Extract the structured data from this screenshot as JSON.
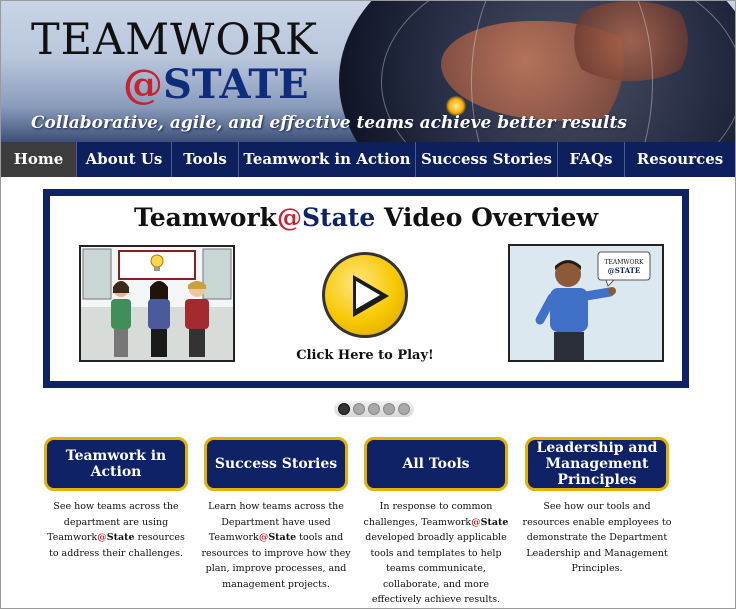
{
  "brand": {
    "line1": "TEAMWORK",
    "at": "@",
    "line2": "STATE",
    "tagline": "Collaborative, agile, and effective teams achieve better results"
  },
  "nav": {
    "items": [
      {
        "label": "Home",
        "active": true
      },
      {
        "label": "About Us"
      },
      {
        "label": "Tools"
      },
      {
        "label": "Teamwork in Action"
      },
      {
        "label": "Success Stories"
      },
      {
        "label": "FAQs"
      },
      {
        "label": "Resources"
      }
    ]
  },
  "video": {
    "title_a": "Teamwork",
    "title_at": "@",
    "title_b": "State",
    "title_c": " Video Overview",
    "play_label": "Click Here to Play!",
    "sign_line1": "TEAMWORK",
    "sign_line2": "@STATE"
  },
  "carousel": {
    "dot_count": 5,
    "active_index": 0
  },
  "cards": [
    {
      "title": "Teamwork in Action",
      "desc_pre": "See how teams across the department are using Teamwork",
      "desc_at": "@",
      "desc_brand": "State",
      "desc_post": " resources to address their challenges."
    },
    {
      "title": "Success Stories",
      "desc_pre": "Learn how teams across the Department have used Teamwork",
      "desc_at": "@",
      "desc_brand": "State",
      "desc_post": " tools and resources to improve how they plan, improve processes, and management projects."
    },
    {
      "title": "All Tools",
      "desc_pre": "In response to common challenges, Teamwork",
      "desc_at": "@",
      "desc_brand": "State",
      "desc_post": " developed broadly applicable tools and templates to help teams communicate, collaborate, and more effectively achieve results."
    },
    {
      "title": "Leadership and Management Principles",
      "desc_pre": "See how our tools and resources enable employees to demonstrate the Department Leadership and Management Principles.",
      "desc_at": "",
      "desc_brand": "",
      "desc_post": ""
    }
  ],
  "colors": {
    "navy": "#0f2266",
    "nav_bg": "#0d1f5c",
    "accent_red": "#c4232f",
    "card_border": "#e3b200",
    "play_yellow": "#f7c800"
  }
}
